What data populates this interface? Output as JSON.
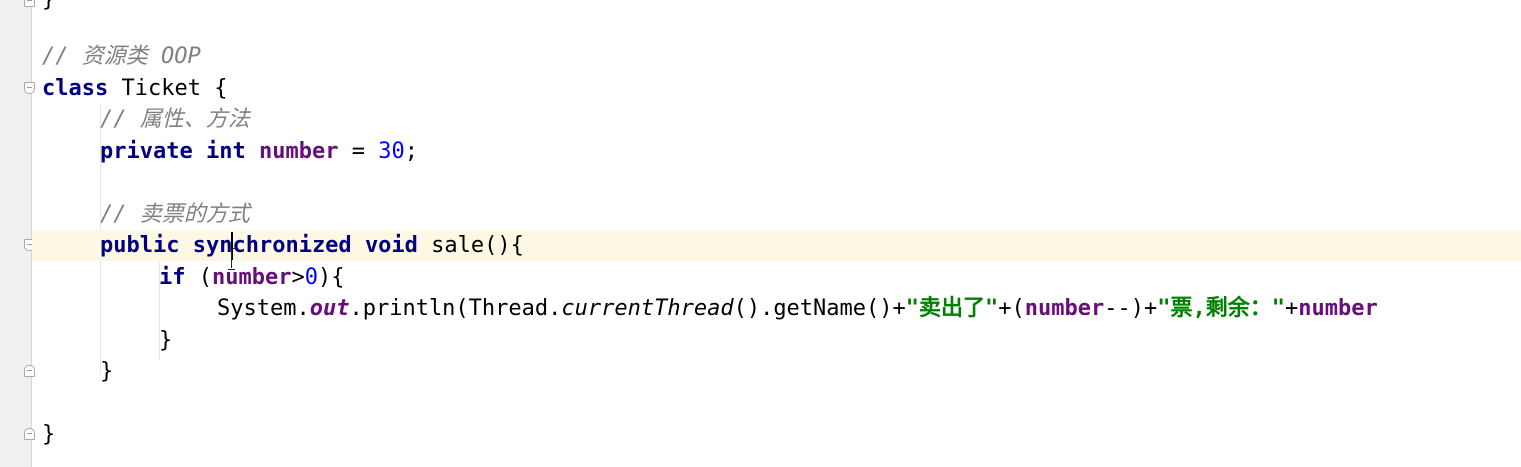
{
  "editor": {
    "lines": [
      {
        "id": "close-prev",
        "tokens": [
          {
            "t": "}",
            "c": ""
          }
        ]
      },
      {
        "id": "comment-resource",
        "tokens": [
          {
            "t": "// 资源类 OOP",
            "c": "cmt"
          }
        ]
      },
      {
        "id": "class-decl",
        "tokens": [
          {
            "t": "class",
            "c": "kw"
          },
          {
            "t": " Ticket {",
            "c": ""
          }
        ]
      },
      {
        "id": "comment-fields",
        "tokens": [
          {
            "t": "// 属性、方法",
            "c": "cmt"
          }
        ]
      },
      {
        "id": "field-decl",
        "tokens": [
          {
            "t": "private",
            "c": "kw"
          },
          {
            "t": " ",
            "c": ""
          },
          {
            "t": "int",
            "c": "kw"
          },
          {
            "t": " ",
            "c": ""
          },
          {
            "t": "number",
            "c": "field"
          },
          {
            "t": " = ",
            "c": ""
          },
          {
            "t": "30",
            "c": "num"
          },
          {
            "t": ";",
            "c": ""
          }
        ]
      },
      {
        "id": "blank-1",
        "tokens": []
      },
      {
        "id": "comment-sale",
        "tokens": [
          {
            "t": "// 卖票的方式",
            "c": "cmt"
          }
        ]
      },
      {
        "id": "method-decl",
        "tokens": [
          {
            "t": "public",
            "c": "kw"
          },
          {
            "t": " ",
            "c": ""
          },
          {
            "t": "synchronized",
            "c": "kw"
          },
          {
            "t": " ",
            "c": ""
          },
          {
            "t": "void",
            "c": "kw"
          },
          {
            "t": " sale(){",
            "c": ""
          }
        ]
      },
      {
        "id": "if-stmt",
        "tokens": [
          {
            "t": "if",
            "c": "kw"
          },
          {
            "t": " (",
            "c": ""
          },
          {
            "t": "number",
            "c": "field"
          },
          {
            "t": ">",
            "c": ""
          },
          {
            "t": "0",
            "c": "num"
          },
          {
            "t": "){",
            "c": ""
          }
        ]
      },
      {
        "id": "println-stmt",
        "tokens": [
          {
            "t": "System.",
            "c": ""
          },
          {
            "t": "out",
            "c": "staticf"
          },
          {
            "t": ".println(Thread.",
            "c": ""
          },
          {
            "t": "currentThread",
            "c": "ital"
          },
          {
            "t": "().getName()+",
            "c": ""
          },
          {
            "t": "\"卖出了\"",
            "c": "str"
          },
          {
            "t": "+(",
            "c": ""
          },
          {
            "t": "number",
            "c": "field"
          },
          {
            "t": "--)+",
            "c": ""
          },
          {
            "t": "\"票,剩余：\"",
            "c": "str"
          },
          {
            "t": "+",
            "c": ""
          },
          {
            "t": "number",
            "c": "field"
          }
        ]
      },
      {
        "id": "if-close",
        "tokens": [
          {
            "t": "}",
            "c": ""
          }
        ]
      },
      {
        "id": "method-close",
        "tokens": [
          {
            "t": "}",
            "c": ""
          }
        ]
      },
      {
        "id": "blank-2",
        "tokens": []
      },
      {
        "id": "class-close",
        "tokens": [
          {
            "t": "}",
            "c": ""
          }
        ]
      }
    ]
  }
}
